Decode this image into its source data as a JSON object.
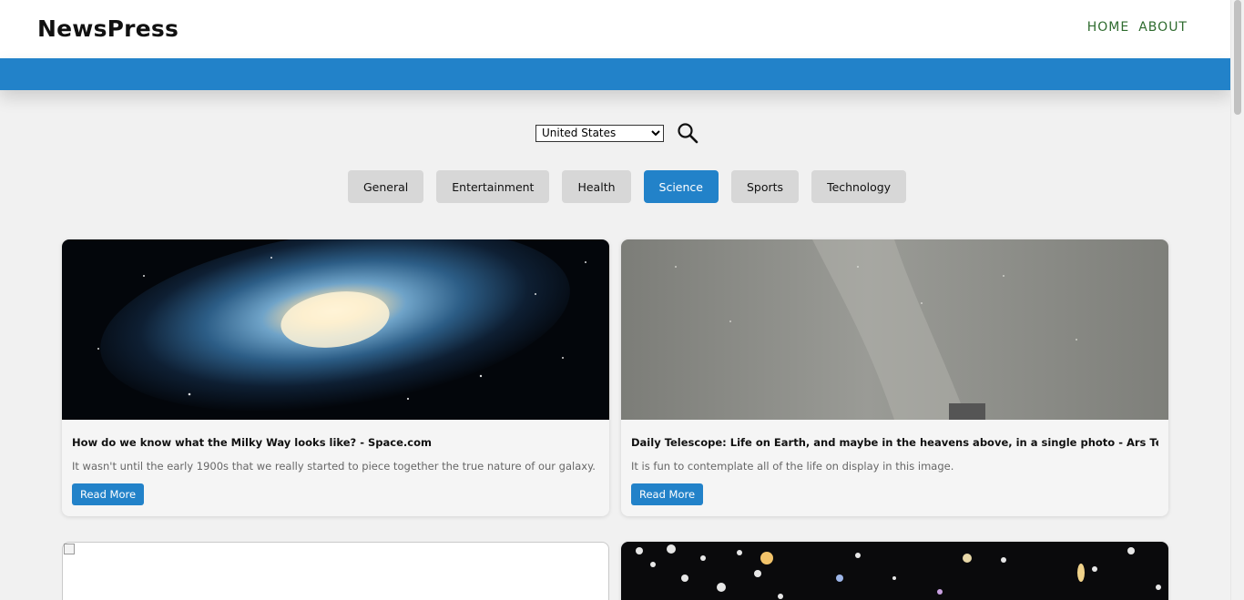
{
  "header": {
    "brand": "NewsPress",
    "nav": {
      "home": "HOME",
      "about": "ABOUT"
    }
  },
  "search": {
    "country": "United States",
    "icon": "search-icon"
  },
  "categories": [
    "General",
    "Entertainment",
    "Health",
    "Science",
    "Sports",
    "Technology"
  ],
  "active_category": "Science",
  "articles": [
    {
      "title": "How do we know what the Milky Way looks like? - Space.com",
      "description": "It wasn't until the early 1900s that we really started to piece together the true nature of our galaxy.",
      "button": "Read More"
    },
    {
      "title": "Daily Telescope: Life on Earth, and maybe in the heavens above, in a single photo - Ars Technica",
      "description": "It is fun to contemplate all of the life on display in this image.",
      "button": "Read More"
    }
  ],
  "colors": {
    "accent": "#2282c9",
    "nav_link": "#2e6b2e",
    "background": "#f1f1f1",
    "category_bg": "#d7d7d7"
  }
}
